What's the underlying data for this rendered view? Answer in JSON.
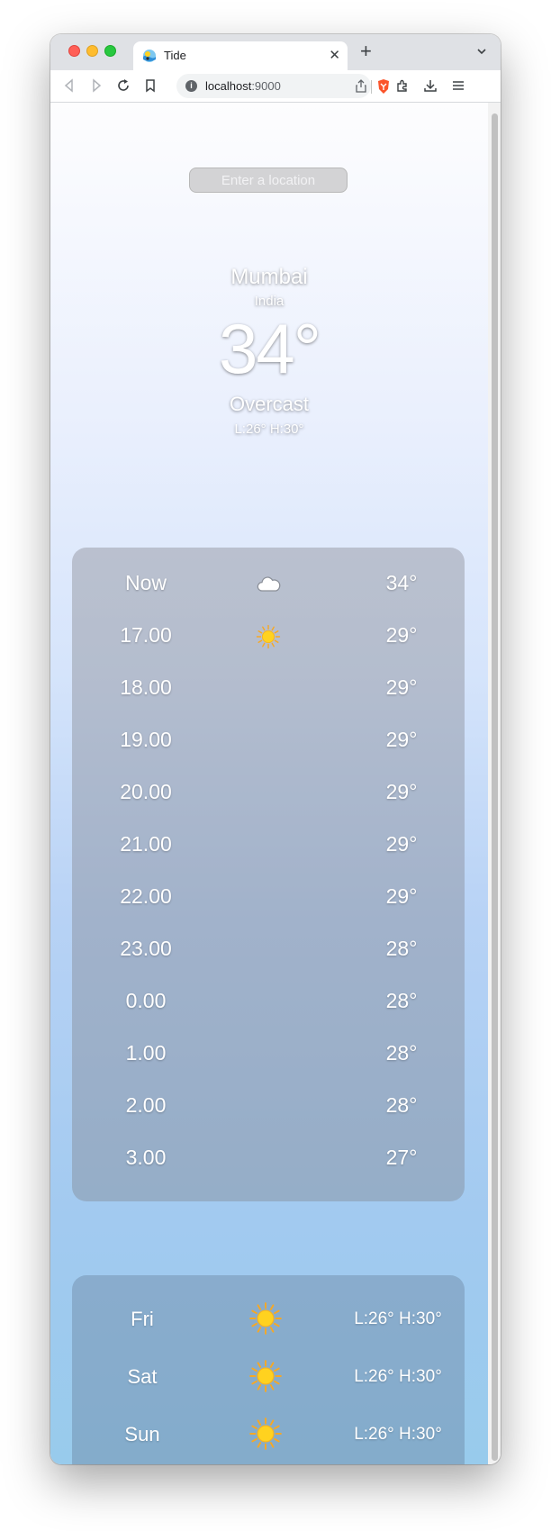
{
  "browser": {
    "tab_title": "Tide",
    "url_host": "localhost",
    "url_port": ":9000"
  },
  "search": {
    "placeholder": "Enter a location"
  },
  "current": {
    "city": "Mumbai",
    "country": "India",
    "temperature": "34°",
    "condition": "Overcast",
    "low_high": "L:26°  H:30°"
  },
  "hourly": [
    {
      "time": "Now",
      "icon": "cloud-icon",
      "temp": "34°"
    },
    {
      "time": "17.00",
      "icon": "sun-icon",
      "temp": "29°"
    },
    {
      "time": "18.00",
      "icon": "moon-icon",
      "temp": "29°"
    },
    {
      "time": "19.00",
      "icon": "moon-icon",
      "temp": "29°"
    },
    {
      "time": "20.00",
      "icon": "moon-icon",
      "temp": "29°"
    },
    {
      "time": "21.00",
      "icon": "moon-icon",
      "temp": "29°"
    },
    {
      "time": "22.00",
      "icon": "moon-icon",
      "temp": "29°"
    },
    {
      "time": "23.00",
      "icon": "moon-icon",
      "temp": "28°"
    },
    {
      "time": "0.00",
      "icon": "moon-icon",
      "temp": "28°"
    },
    {
      "time": "1.00",
      "icon": "moon-icon",
      "temp": "28°"
    },
    {
      "time": "2.00",
      "icon": "moon-icon",
      "temp": "28°"
    },
    {
      "time": "3.00",
      "icon": "moon-icon",
      "temp": "27°"
    }
  ],
  "daily": [
    {
      "day": "Fri",
      "icon": "sun-icon",
      "range": "L:26° H:30°"
    },
    {
      "day": "Sat",
      "icon": "sun-icon",
      "range": "L:26° H:30°"
    },
    {
      "day": "Sun",
      "icon": "sun-icon",
      "range": "L:26° H:30°"
    }
  ],
  "colors": {
    "sun": "#ffd21f",
    "moon": "#3a6fd0",
    "cloud": "#ffffff"
  }
}
